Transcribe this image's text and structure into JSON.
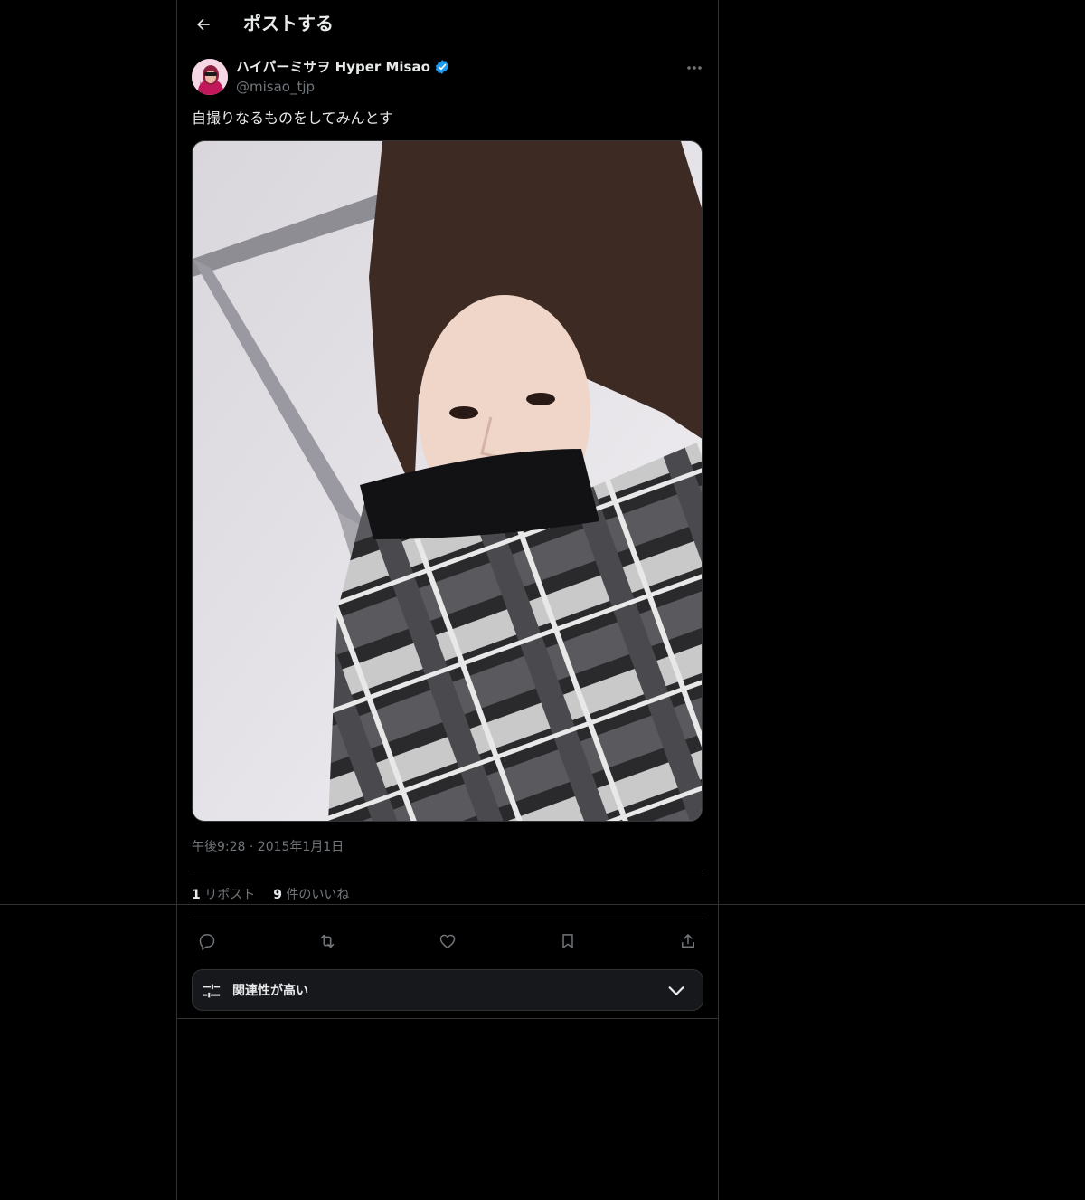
{
  "header": {
    "title": "ポストする",
    "back_icon": "arrow-left-icon"
  },
  "post": {
    "author_name": "ハイパーミサヲ Hyper Misao",
    "verified_icon": "verified-badge-icon",
    "handle": "@misao_tjp",
    "more_icon": "more-horizontal-icon",
    "text": "自撮りなるものをしてみんとす",
    "timestamp": "午後9:28 · 2015年1月1日",
    "reposts": {
      "count": "1",
      "label": "リポスト"
    },
    "likes": {
      "count": "9",
      "label": "件のいいね"
    }
  },
  "actions": [
    "reply-icon",
    "repost-icon",
    "like-icon",
    "bookmark-icon",
    "share-icon"
  ],
  "sort": {
    "label": "関連性が高い",
    "icon": "sliders-icon",
    "chevron": "chevron-down-icon"
  },
  "colors": {
    "background": "#000000",
    "border": "#2f3336",
    "text": "#e7e9ea",
    "muted": "#71767b",
    "verified": "#1d9bf0"
  }
}
